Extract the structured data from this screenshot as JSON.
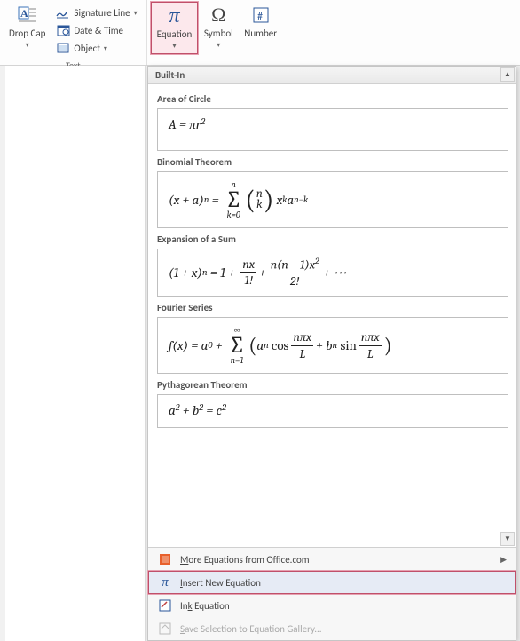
{
  "ribbon": {
    "drop_cap": {
      "label": "Drop Cap"
    },
    "signature": "Signature Line",
    "datetime": "Date & Time",
    "object": "Object",
    "text_group": "Text",
    "equation": {
      "label": "Equation"
    },
    "symbol": {
      "label": "Symbol"
    },
    "number": {
      "label": "Number"
    }
  },
  "dropdown": {
    "header": "Built-In",
    "items": [
      {
        "title": "Area of Circle"
      },
      {
        "title": "Binomial Theorem"
      },
      {
        "title": "Expansion of a Sum"
      },
      {
        "title": "Fourier Series"
      },
      {
        "title": "Pythagorean Theorem"
      }
    ],
    "footer": {
      "more": "More Equations from Office.com",
      "insert_new": "Insert New Equation",
      "ink": "Ink Equation",
      "save": "Save Selection to Equation Gallery..."
    }
  },
  "equations_latex": {
    "area_of_circle": "A = \\pi r^2",
    "binomial_theorem": "(x+a)^n = \\sum_{k=0}^{n} \\binom{n}{k} x^k a^{n-k}",
    "expansion_of_sum": "(1+x)^n = 1 + \\frac{nx}{1!} + \\frac{n(n-1)x^2}{2!} + \\cdots",
    "fourier_series": "f(x) = a_0 + \\sum_{n=1}^{\\infty} \\left(a_n \\cos\\frac{n\\pi x}{L} + b_n \\sin\\frac{n\\pi x}{L}\\right)",
    "pythagorean_theorem": "a^2 + b^2 = c^2"
  }
}
